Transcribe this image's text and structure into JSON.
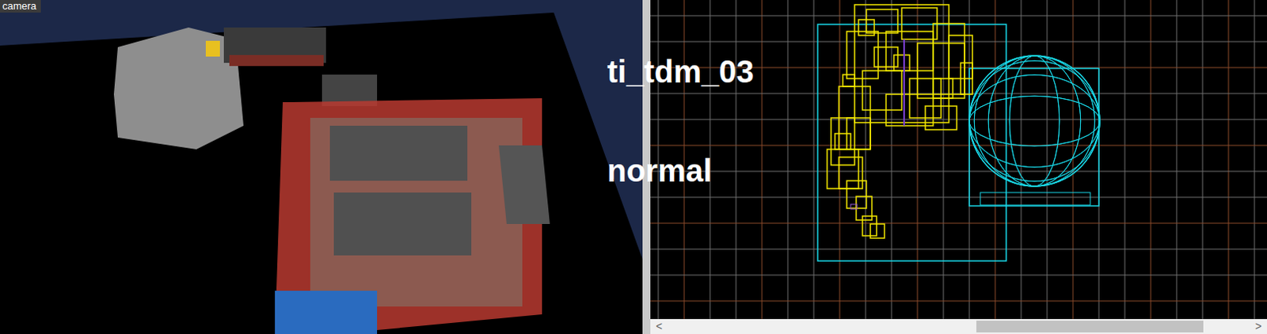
{
  "viewports": {
    "camera": {
      "label": "camera"
    },
    "top": {
      "label": ""
    }
  },
  "overlay": [
    {
      "text": "ti_tdm_03"
    },
    {
      "text": "normal"
    }
  ],
  "scrollbar": {
    "left_arrow": "<",
    "right_arrow": ">",
    "level": 0.53,
    "thumb": 0.39
  }
}
